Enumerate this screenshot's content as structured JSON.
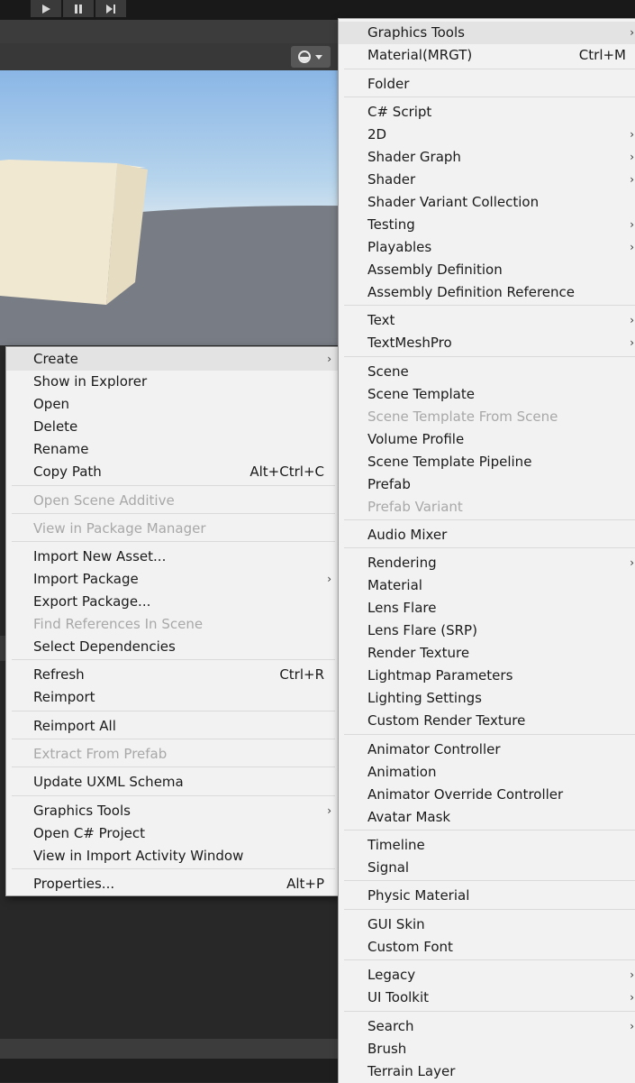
{
  "background": {
    "scene_colors": {
      "sky": "#8ab6e6",
      "ground": "#787c84",
      "cube": "#efe6cf"
    }
  },
  "toolbar": {
    "play_icon": "play-icon",
    "pause_icon": "pause-icon",
    "step_icon": "step-icon",
    "gizmo_icon": "gizmo-icon"
  },
  "context_menu": {
    "items": [
      {
        "label": "Create",
        "shortcut": "",
        "submenu": true,
        "disabled": false,
        "highlighted": true
      },
      {
        "label": "Show in Explorer",
        "shortcut": "",
        "submenu": false,
        "disabled": false
      },
      {
        "label": "Open",
        "shortcut": "",
        "submenu": false,
        "disabled": false
      },
      {
        "label": "Delete",
        "shortcut": "",
        "submenu": false,
        "disabled": false
      },
      {
        "label": "Rename",
        "shortcut": "",
        "submenu": false,
        "disabled": false
      },
      {
        "label": "Copy Path",
        "shortcut": "Alt+Ctrl+C",
        "submenu": false,
        "disabled": false
      },
      {
        "label": "Open Scene Additive",
        "shortcut": "",
        "submenu": false,
        "disabled": true
      },
      {
        "label": "View in Package Manager",
        "shortcut": "",
        "submenu": false,
        "disabled": true
      },
      {
        "label": "Import New Asset...",
        "shortcut": "",
        "submenu": false,
        "disabled": false
      },
      {
        "label": "Import Package",
        "shortcut": "",
        "submenu": true,
        "disabled": false
      },
      {
        "label": "Export Package...",
        "shortcut": "",
        "submenu": false,
        "disabled": false
      },
      {
        "label": "Find References In Scene",
        "shortcut": "",
        "submenu": false,
        "disabled": true
      },
      {
        "label": "Select Dependencies",
        "shortcut": "",
        "submenu": false,
        "disabled": false
      },
      {
        "label": "Refresh",
        "shortcut": "Ctrl+R",
        "submenu": false,
        "disabled": false
      },
      {
        "label": "Reimport",
        "shortcut": "",
        "submenu": false,
        "disabled": false
      },
      {
        "label": "Reimport All",
        "shortcut": "",
        "submenu": false,
        "disabled": false
      },
      {
        "label": "Extract From Prefab",
        "shortcut": "",
        "submenu": false,
        "disabled": true
      },
      {
        "label": "Update UXML Schema",
        "shortcut": "",
        "submenu": false,
        "disabled": false
      },
      {
        "label": "Graphics Tools",
        "shortcut": "",
        "submenu": true,
        "disabled": false
      },
      {
        "label": "Open C# Project",
        "shortcut": "",
        "submenu": false,
        "disabled": false
      },
      {
        "label": "View in Import Activity Window",
        "shortcut": "",
        "submenu": false,
        "disabled": false
      },
      {
        "label": "Properties...",
        "shortcut": "Alt+P",
        "submenu": false,
        "disabled": false
      }
    ]
  },
  "create_submenu": {
    "items": [
      {
        "label": "Graphics Tools",
        "shortcut": "",
        "submenu": true,
        "disabled": false,
        "highlighted": true
      },
      {
        "label": "Material(MRGT)",
        "shortcut": "Ctrl+M",
        "submenu": false,
        "disabled": false
      },
      {
        "label": "Folder",
        "shortcut": "",
        "submenu": false,
        "disabled": false
      },
      {
        "label": "C# Script",
        "shortcut": "",
        "submenu": false,
        "disabled": false
      },
      {
        "label": "2D",
        "shortcut": "",
        "submenu": true,
        "disabled": false
      },
      {
        "label": "Shader Graph",
        "shortcut": "",
        "submenu": true,
        "disabled": false
      },
      {
        "label": "Shader",
        "shortcut": "",
        "submenu": true,
        "disabled": false
      },
      {
        "label": "Shader Variant Collection",
        "shortcut": "",
        "submenu": false,
        "disabled": false
      },
      {
        "label": "Testing",
        "shortcut": "",
        "submenu": true,
        "disabled": false
      },
      {
        "label": "Playables",
        "shortcut": "",
        "submenu": true,
        "disabled": false
      },
      {
        "label": "Assembly Definition",
        "shortcut": "",
        "submenu": false,
        "disabled": false
      },
      {
        "label": "Assembly Definition Reference",
        "shortcut": "",
        "submenu": false,
        "disabled": false
      },
      {
        "label": "Text",
        "shortcut": "",
        "submenu": true,
        "disabled": false
      },
      {
        "label": "TextMeshPro",
        "shortcut": "",
        "submenu": true,
        "disabled": false
      },
      {
        "label": "Scene",
        "shortcut": "",
        "submenu": false,
        "disabled": false
      },
      {
        "label": "Scene Template",
        "shortcut": "",
        "submenu": false,
        "disabled": false
      },
      {
        "label": "Scene Template From Scene",
        "shortcut": "",
        "submenu": false,
        "disabled": true
      },
      {
        "label": "Volume Profile",
        "shortcut": "",
        "submenu": false,
        "disabled": false
      },
      {
        "label": "Scene Template Pipeline",
        "shortcut": "",
        "submenu": false,
        "disabled": false
      },
      {
        "label": "Prefab",
        "shortcut": "",
        "submenu": false,
        "disabled": false
      },
      {
        "label": "Prefab Variant",
        "shortcut": "",
        "submenu": false,
        "disabled": true
      },
      {
        "label": "Audio Mixer",
        "shortcut": "",
        "submenu": false,
        "disabled": false
      },
      {
        "label": "Rendering",
        "shortcut": "",
        "submenu": true,
        "disabled": false
      },
      {
        "label": "Material",
        "shortcut": "",
        "submenu": false,
        "disabled": false
      },
      {
        "label": "Lens Flare",
        "shortcut": "",
        "submenu": false,
        "disabled": false
      },
      {
        "label": "Lens Flare (SRP)",
        "shortcut": "",
        "submenu": false,
        "disabled": false
      },
      {
        "label": "Render Texture",
        "shortcut": "",
        "submenu": false,
        "disabled": false
      },
      {
        "label": "Lightmap Parameters",
        "shortcut": "",
        "submenu": false,
        "disabled": false
      },
      {
        "label": "Lighting Settings",
        "shortcut": "",
        "submenu": false,
        "disabled": false
      },
      {
        "label": "Custom Render Texture",
        "shortcut": "",
        "submenu": false,
        "disabled": false
      },
      {
        "label": "Animator Controller",
        "shortcut": "",
        "submenu": false,
        "disabled": false
      },
      {
        "label": "Animation",
        "shortcut": "",
        "submenu": false,
        "disabled": false
      },
      {
        "label": "Animator Override Controller",
        "shortcut": "",
        "submenu": false,
        "disabled": false
      },
      {
        "label": "Avatar Mask",
        "shortcut": "",
        "submenu": false,
        "disabled": false
      },
      {
        "label": "Timeline",
        "shortcut": "",
        "submenu": false,
        "disabled": false
      },
      {
        "label": "Signal",
        "shortcut": "",
        "submenu": false,
        "disabled": false
      },
      {
        "label": "Physic Material",
        "shortcut": "",
        "submenu": false,
        "disabled": false
      },
      {
        "label": "GUI Skin",
        "shortcut": "",
        "submenu": false,
        "disabled": false
      },
      {
        "label": "Custom Font",
        "shortcut": "",
        "submenu": false,
        "disabled": false
      },
      {
        "label": "Legacy",
        "shortcut": "",
        "submenu": true,
        "disabled": false
      },
      {
        "label": "UI Toolkit",
        "shortcut": "",
        "submenu": true,
        "disabled": false
      },
      {
        "label": "Search",
        "shortcut": "",
        "submenu": true,
        "disabled": false
      },
      {
        "label": "Brush",
        "shortcut": "",
        "submenu": false,
        "disabled": false
      },
      {
        "label": "Terrain Layer",
        "shortcut": "",
        "submenu": false,
        "disabled": false
      }
    ]
  }
}
